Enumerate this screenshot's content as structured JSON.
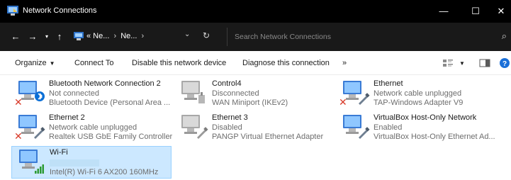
{
  "window": {
    "title": "Network Connections",
    "controls": {
      "minimize": "—",
      "maximize": "☐",
      "close": "✕"
    }
  },
  "address": {
    "crumb1": "« Ne...",
    "separator": "›",
    "crumb2": "Ne...",
    "search_placeholder": "Search Network Connections"
  },
  "toolbar": {
    "organize": "Organize",
    "connect_to": "Connect To",
    "disable": "Disable this network device",
    "diagnose": "Diagnose this connection",
    "more": "»"
  },
  "connections": [
    {
      "name": "Bluetooth Network Connection 2",
      "status": "Not connected",
      "device": "Bluetooth Device (Personal Area ...",
      "icon": "bluetooth-adapter-icon",
      "badge": "x"
    },
    {
      "name": "Control4",
      "status": "Disconnected",
      "device": "WAN Miniport (IKEv2)",
      "icon": "vpn-adapter-icon",
      "badge": "none"
    },
    {
      "name": "Ethernet",
      "status": "Network cable unplugged",
      "device": "TAP-Windows Adapter V9",
      "icon": "ethernet-adapter-icon",
      "badge": "x"
    },
    {
      "name": "Ethernet 2",
      "status": "Network cable unplugged",
      "device": "Realtek USB GbE Family Controller",
      "icon": "ethernet-adapter-icon",
      "badge": "x"
    },
    {
      "name": "Ethernet 3",
      "status": "Disabled",
      "device": "PANGP Virtual Ethernet Adapter",
      "icon": "ethernet-adapter-icon",
      "badge": "none"
    },
    {
      "name": "VirtualBox Host-Only Network",
      "status": "Enabled",
      "device": "VirtualBox Host-Only Ethernet Ad...",
      "icon": "ethernet-adapter-icon",
      "badge": "none"
    },
    {
      "name": "Wi-Fi",
      "status": "",
      "device": "Intel(R) Wi-Fi 6 AX200 160MHz",
      "icon": "wifi-adapter-icon",
      "badge": "signal"
    }
  ],
  "colors": {
    "selection": "#cce8ff",
    "titlebar": "#000000",
    "addressbar": "#191919",
    "error_red": "#d83b2a",
    "bluetooth_blue": "#0a6fd6",
    "signal_green": "#2e9b35"
  }
}
